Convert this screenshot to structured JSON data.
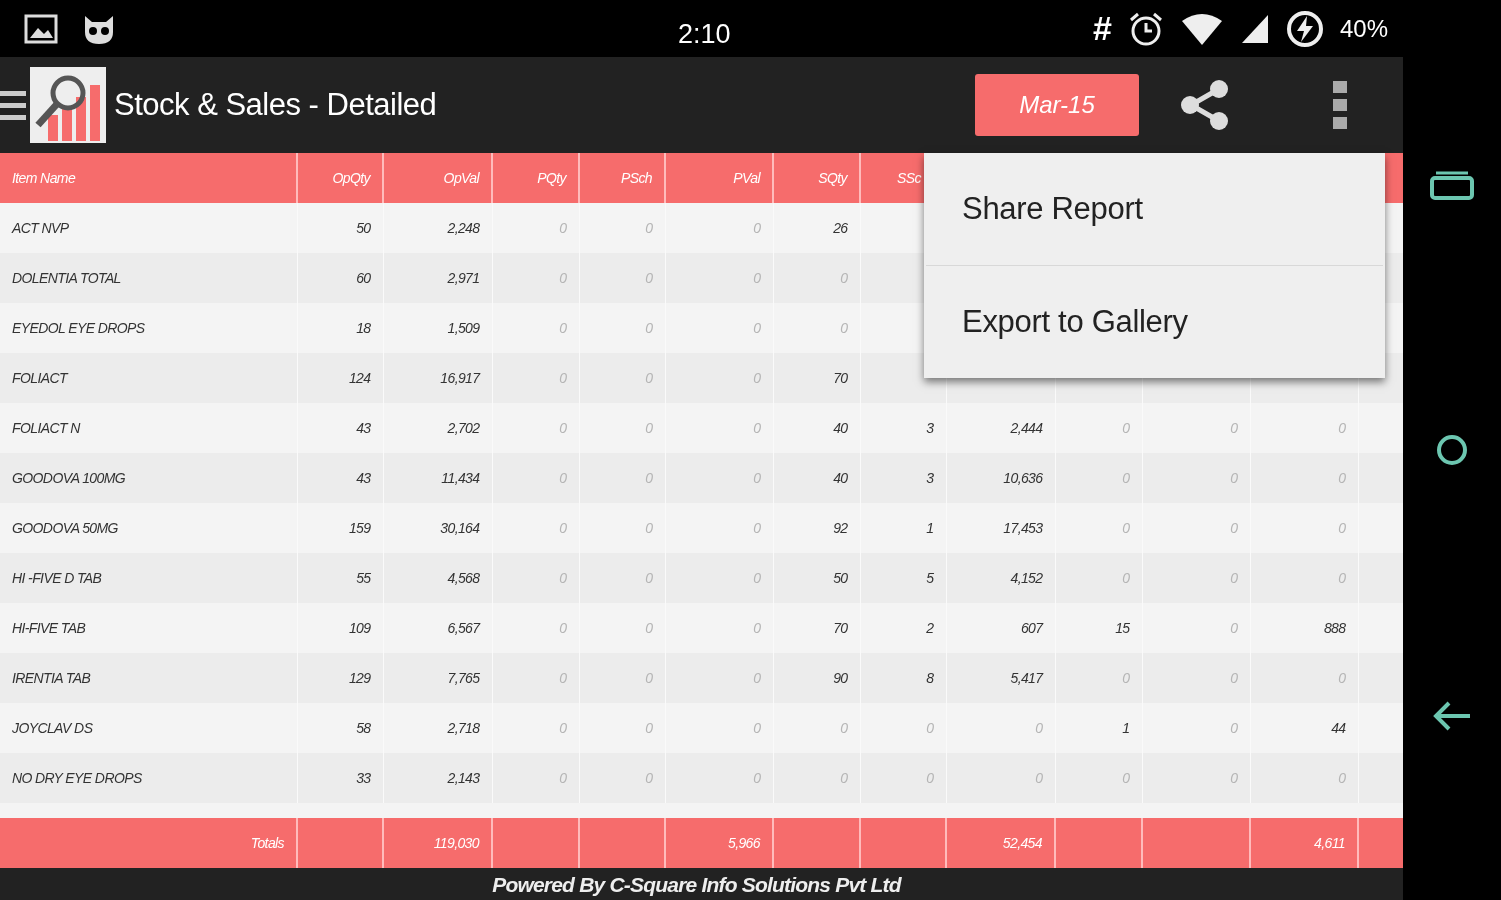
{
  "status_bar": {
    "time": "2:10",
    "hash": "#",
    "battery": "40%"
  },
  "app_bar": {
    "title": "Stock & Sales - Detailed",
    "period_button": "Mar-15"
  },
  "table": {
    "columns": [
      "Item Name",
      "OpQty",
      "OpVal",
      "PQty",
      "PSch",
      "PVal",
      "SQty",
      "SSc"
    ],
    "rows": [
      {
        "cells": [
          "ACT NVP",
          "50",
          "2,248",
          "0",
          "0",
          "0",
          "26"
        ]
      },
      {
        "cells": [
          "DOLENTIA TOTAL",
          "60",
          "2,971",
          "0",
          "0",
          "0",
          "0"
        ]
      },
      {
        "cells": [
          "EYEDOL EYE DROPS",
          "18",
          "1,509",
          "0",
          "0",
          "0",
          "0"
        ]
      },
      {
        "cells": [
          "FOLIACT",
          "124",
          "16,917",
          "0",
          "0",
          "0",
          "70"
        ]
      },
      {
        "cells": [
          "FOLIACT N",
          "43",
          "2,702",
          "0",
          "0",
          "0",
          "40",
          "3",
          "2,444",
          "0",
          "0",
          "0"
        ]
      },
      {
        "cells": [
          "GOODOVA 100MG",
          "43",
          "11,434",
          "0",
          "0",
          "0",
          "40",
          "3",
          "10,636",
          "0",
          "0",
          "0"
        ]
      },
      {
        "cells": [
          "GOODOVA 50MG",
          "159",
          "30,164",
          "0",
          "0",
          "0",
          "92",
          "1",
          "17,453",
          "0",
          "0",
          "0"
        ]
      },
      {
        "cells": [
          "HI -FIVE D TAB",
          "55",
          "4,568",
          "0",
          "0",
          "0",
          "50",
          "5",
          "4,152",
          "0",
          "0",
          "0"
        ]
      },
      {
        "cells": [
          "HI-FIVE TAB",
          "109",
          "6,567",
          "0",
          "0",
          "0",
          "70",
          "2",
          "607",
          "15",
          "0",
          "888"
        ]
      },
      {
        "cells": [
          "IRENTIA TAB",
          "129",
          "7,765",
          "0",
          "0",
          "0",
          "90",
          "8",
          "5,417",
          "0",
          "0",
          "0"
        ]
      },
      {
        "cells": [
          "JOYCLAV DS",
          "58",
          "2,718",
          "0",
          "0",
          "0",
          "0",
          "0",
          "0",
          "1",
          "0",
          "44"
        ]
      },
      {
        "cells": [
          "NO DRY EYE DROPS",
          "33",
          "2,143",
          "0",
          "0",
          "0",
          "0",
          "0",
          "0",
          "0",
          "0",
          "0"
        ]
      }
    ],
    "totals": [
      {
        "kind": "label",
        "text": "Totals"
      },
      {
        "kind": "blank"
      },
      {
        "kind": "value",
        "text": "119,030"
      },
      {
        "kind": "blank"
      },
      {
        "kind": "blank"
      },
      {
        "kind": "value",
        "text": "5,966"
      },
      {
        "kind": "blank"
      },
      {
        "kind": "blank"
      },
      {
        "kind": "value",
        "text": "52,454"
      },
      {
        "kind": "blank"
      },
      {
        "kind": "blank"
      },
      {
        "kind": "value",
        "text": "4,611"
      }
    ]
  },
  "menu": {
    "items": [
      "Share Report",
      "Export to Gallery"
    ]
  },
  "footer": "Powered By C-Square Info Solutions Pvt Ltd"
}
